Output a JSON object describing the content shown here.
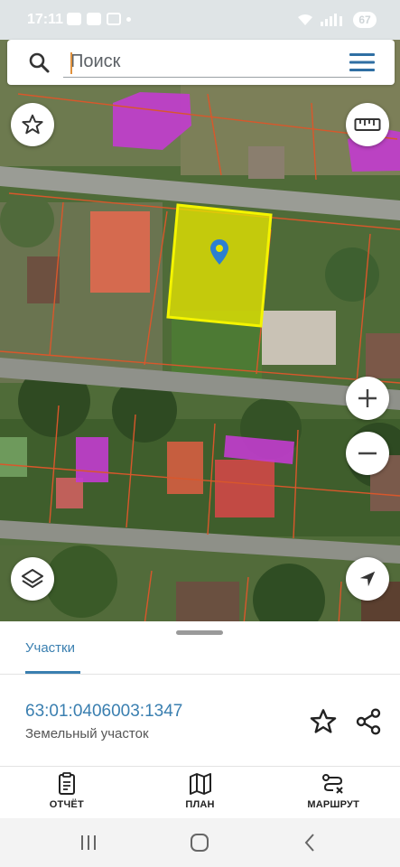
{
  "status_bar": {
    "time": "17:11",
    "battery": "67",
    "icons": [
      "notification-icon",
      "messenger-icon",
      "vk-icon",
      "dot-icon",
      "wifi-icon",
      "signal-icon",
      "battery-icon"
    ]
  },
  "search": {
    "placeholder": "Поиск",
    "search_icon": "search-icon",
    "menu_icon": "hamburger-menu-icon"
  },
  "map": {
    "buttons": {
      "favorites": "star-icon",
      "ruler": "ruler-icon",
      "zoom_in": "plus-icon",
      "zoom_out": "minus-icon",
      "layers": "layers-icon",
      "locate": "navigation-arrow-icon"
    },
    "selected_parcel_color": "#e6e600",
    "parcel_border_color": "#d9572b",
    "building_highlight_color": "#c23ccf",
    "marker_color": "#2c7fd1"
  },
  "panel": {
    "tab_label": "Участки",
    "cadastral_number": "63:01:0406003:1347",
    "object_type": "Земельный участок"
  },
  "bottom_nav": {
    "report": "ОТЧЁТ",
    "plan": "ПЛАН",
    "route": "МАРШРУТ"
  },
  "colors": {
    "accent": "#3a7fb0"
  }
}
